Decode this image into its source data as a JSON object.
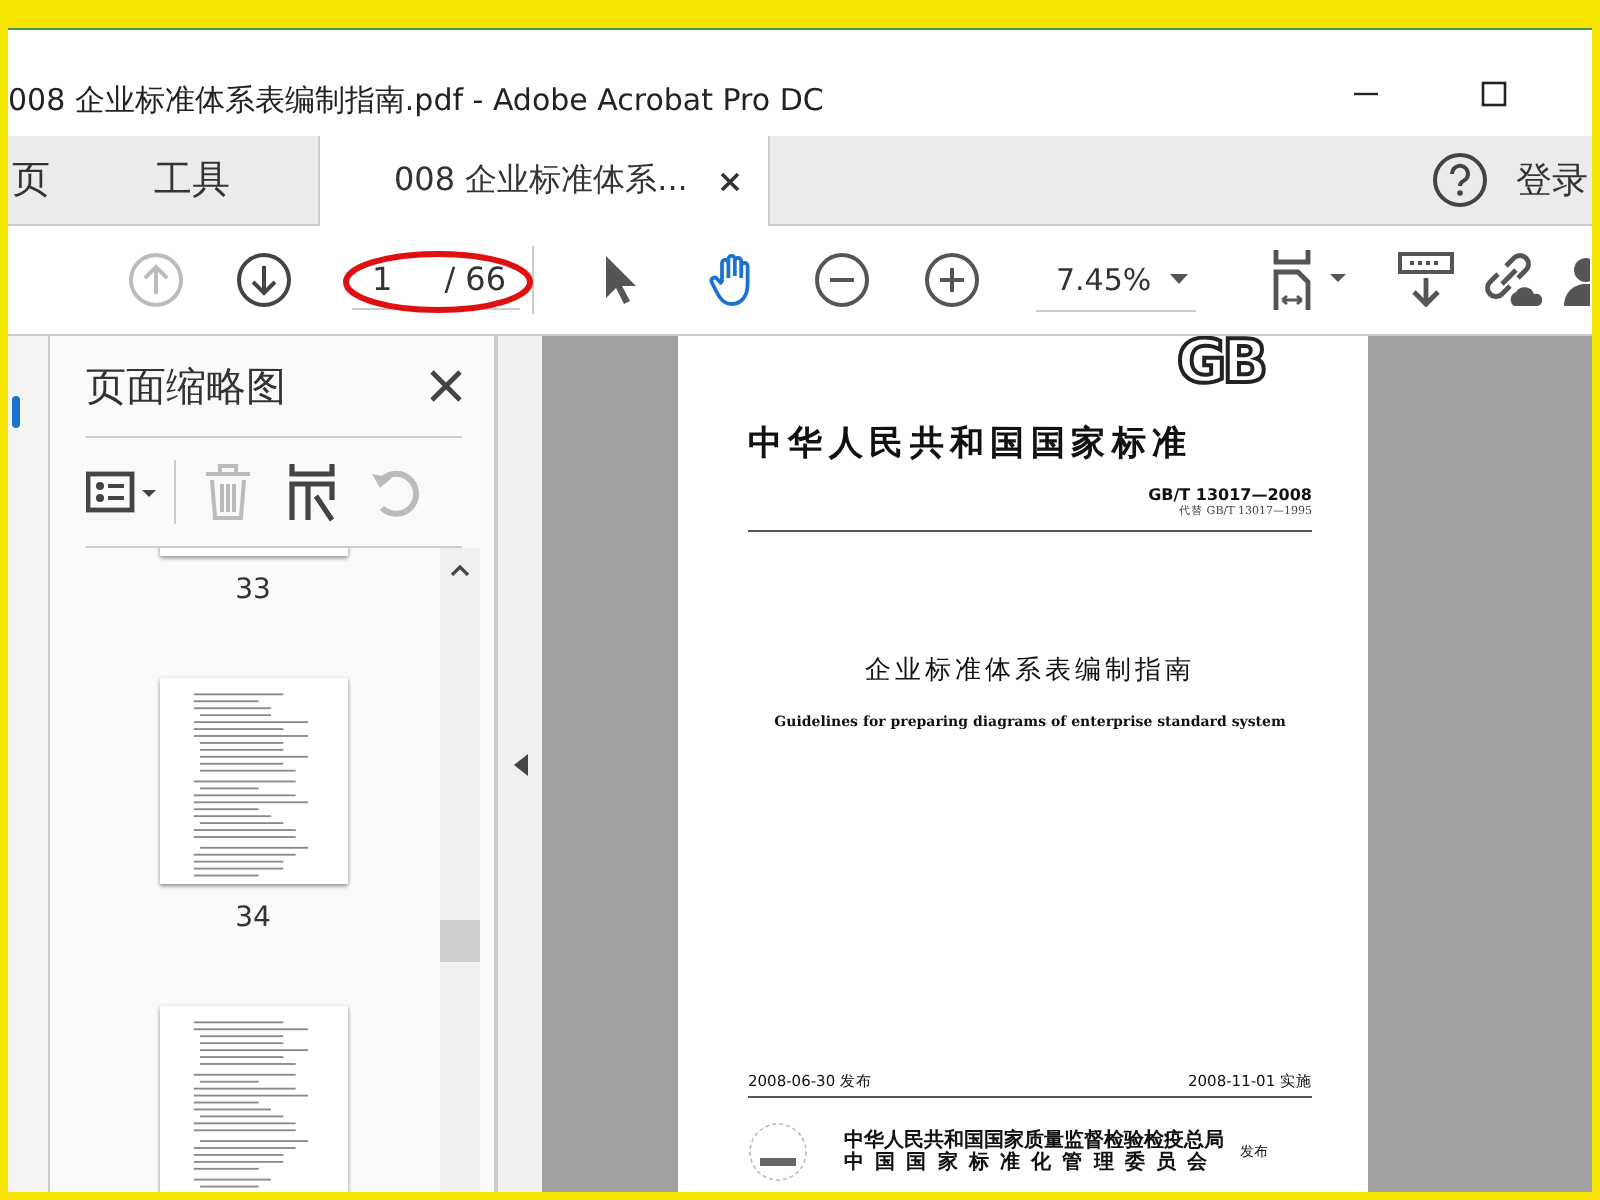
{
  "window": {
    "title": "008  企业标准体系表编制指南.pdf - Adobe Acrobat Pro DC"
  },
  "tabs": [
    {
      "label": "页",
      "selected": false
    },
    {
      "label": "工具",
      "selected": false
    },
    {
      "label": "008  企业标准体系...",
      "selected": true
    }
  ],
  "sign_in": "登录",
  "toolbar": {
    "nav": [
      {
        "kind": "prev",
        "disabled": true
      },
      {
        "kind": "next",
        "disabled": false
      }
    ],
    "page_number": "1",
    "page_total": "/ 66",
    "tools": [
      {
        "kind": "select",
        "selected": false
      },
      {
        "kind": "hand",
        "selected": true
      }
    ],
    "zoom": "7.45%"
  },
  "thumbnail_panel": {
    "title": "页面缩略图",
    "actions": [
      {
        "kind": "options",
        "disabled": false
      },
      {
        "kind": "delete",
        "disabled": true
      },
      {
        "kind": "insert",
        "disabled": false
      },
      {
        "kind": "rotate",
        "disabled": true
      }
    ],
    "pages": [
      {
        "label": "33",
        "kind": "tail"
      },
      {
        "label": "34",
        "kind": "full"
      },
      {
        "kind": "head"
      }
    ]
  },
  "document": {
    "logo": "GB",
    "heading": "中华人民共和国国家标准",
    "standard_number": "GB/T 13017—2008",
    "replaces": "代替 GB/T 13017—1995",
    "title": "企业标准体系表编制指南",
    "subtitle": "Guidelines for preparing diagrams of enterprise standard system",
    "issue_date": "2008-06-30 发布",
    "effective_date": "2008-11-01 实施",
    "issuers": [
      "中华人民共和国国家质量监督检验检疫总局",
      "中国国家标准化管理委员会"
    ],
    "issued": "发布"
  }
}
